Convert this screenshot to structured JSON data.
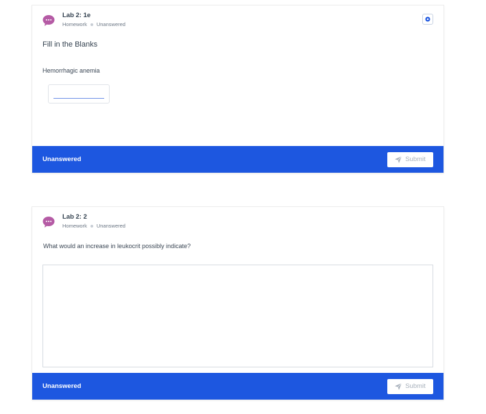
{
  "colors": {
    "accent_blue": "#1d57e0",
    "bubble_pink": "#b55ba5",
    "submit_disabled_text": "#a7b0bb"
  },
  "cards": [
    {
      "icon": "chat-bubble-icon",
      "title": "Lab 2: 1e",
      "type": "Homework",
      "status_tag": "Unanswered",
      "corner_icon": "bookmark-icon",
      "section_title": "Fill in the Blanks",
      "prompt": "Hemorrhagic anemia",
      "blank_value": "",
      "footer_status": "Unanswered",
      "submit_label": "Submit",
      "submit_icon": "paper-plane-icon"
    },
    {
      "icon": "chat-bubble-icon",
      "title": "Lab 2: 2",
      "type": "Homework",
      "status_tag": "Unanswered",
      "question": "What would an increase in leukocrit possibly indicate?",
      "answer_value": "",
      "footer_status": "Unanswered",
      "submit_label": "Submit",
      "submit_icon": "paper-plane-icon"
    }
  ]
}
